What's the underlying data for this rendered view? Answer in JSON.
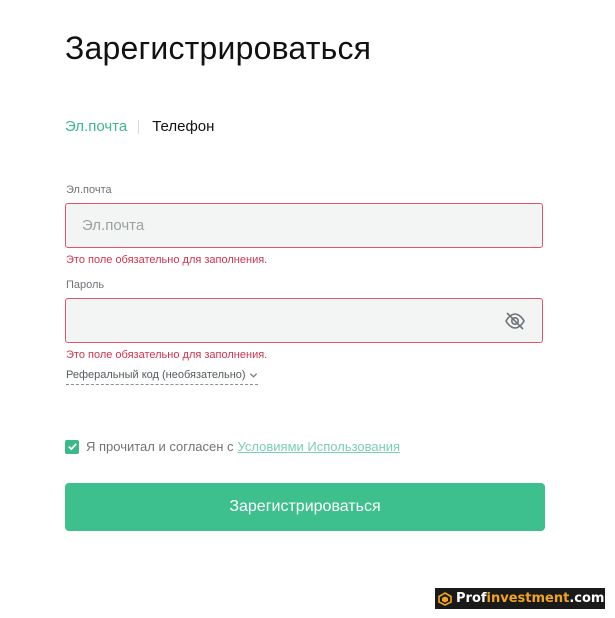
{
  "page": {
    "title": "Зарегистрироваться"
  },
  "tabs": {
    "email": "Эл.почта",
    "phone": "Телефон"
  },
  "email_field": {
    "label": "Эл.почта",
    "placeholder": "Эл.почта",
    "value": "",
    "error": "Это поле обязательно для заполнения."
  },
  "password_field": {
    "label": "Пароль",
    "value": "",
    "error": "Это поле обязательно для заполнения."
  },
  "referral": {
    "label": "Реферальный код (необязательно)"
  },
  "agreement": {
    "text": "Я прочитал и согласен с",
    "link": "Условиями Использования",
    "checked": true
  },
  "submit": {
    "label": "Зарегистрироваться"
  },
  "watermark": {
    "part1": "Prof",
    "part2": "investment",
    "part3": ".com"
  },
  "colors": {
    "accent": "#3cb98a",
    "error": "#d2324c",
    "error_border": "#e0556a",
    "input_bg": "#f3f5f4"
  }
}
